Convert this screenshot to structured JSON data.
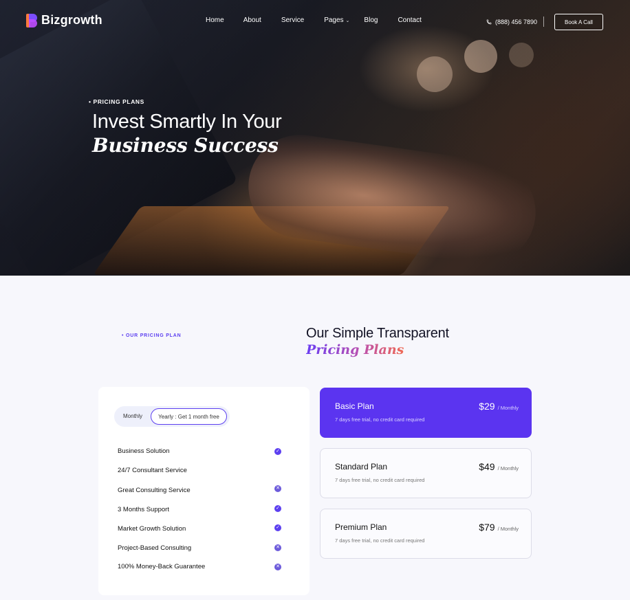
{
  "brand": {
    "name": "Bizgrowth"
  },
  "nav": {
    "items": [
      {
        "label": "Home"
      },
      {
        "label": "About"
      },
      {
        "label": "Service"
      },
      {
        "label": "Pages",
        "dropdown": true
      },
      {
        "label": "Blog"
      },
      {
        "label": "Contact"
      }
    ],
    "phone": "(888) 456 7890",
    "cta": "Book A Call"
  },
  "hero": {
    "tag": "PRICING PLANS",
    "title_line1": "Invest Smartly In Your",
    "title_line2": "Business Success"
  },
  "pricing": {
    "tag": "OUR PRICING PLAN",
    "title_line1": "Our Simple Transparent",
    "title_line2": "Pricing Plans",
    "toggle": {
      "monthly": "Monthly",
      "yearly": "Yearly : Get 1 month free",
      "selected": "yearly"
    },
    "features": [
      {
        "label": "Business Solution",
        "status": "check"
      },
      {
        "label": "24/7 Consultant Service",
        "status": "none"
      },
      {
        "label": "Great Consulting Service",
        "status": "cross"
      },
      {
        "label": "3 Months Support",
        "status": "check"
      },
      {
        "label": "Market Growth Solution",
        "status": "check"
      },
      {
        "label": "Project-Based Consulting",
        "status": "cross"
      },
      {
        "label": "100% Money-Back Guarantee",
        "status": "cross"
      }
    ],
    "plans": [
      {
        "name": "Basic Plan",
        "price": "$29",
        "period": "/ Monthly",
        "desc": "7 days free trial, no credit card required",
        "active": true
      },
      {
        "name": "Standard Plan",
        "price": "$49",
        "period": "/ Monthly",
        "desc": "7 days free trial, no credit card required",
        "active": false
      },
      {
        "name": "Premium Plan",
        "price": "$79",
        "period": "/ Monthly",
        "desc": "7 days free trial, no credit card required",
        "active": false
      }
    ]
  },
  "colors": {
    "accent": "#5b34f0",
    "logo_orange": "#ff7a3d",
    "logo_purple": "#7b4dff"
  }
}
